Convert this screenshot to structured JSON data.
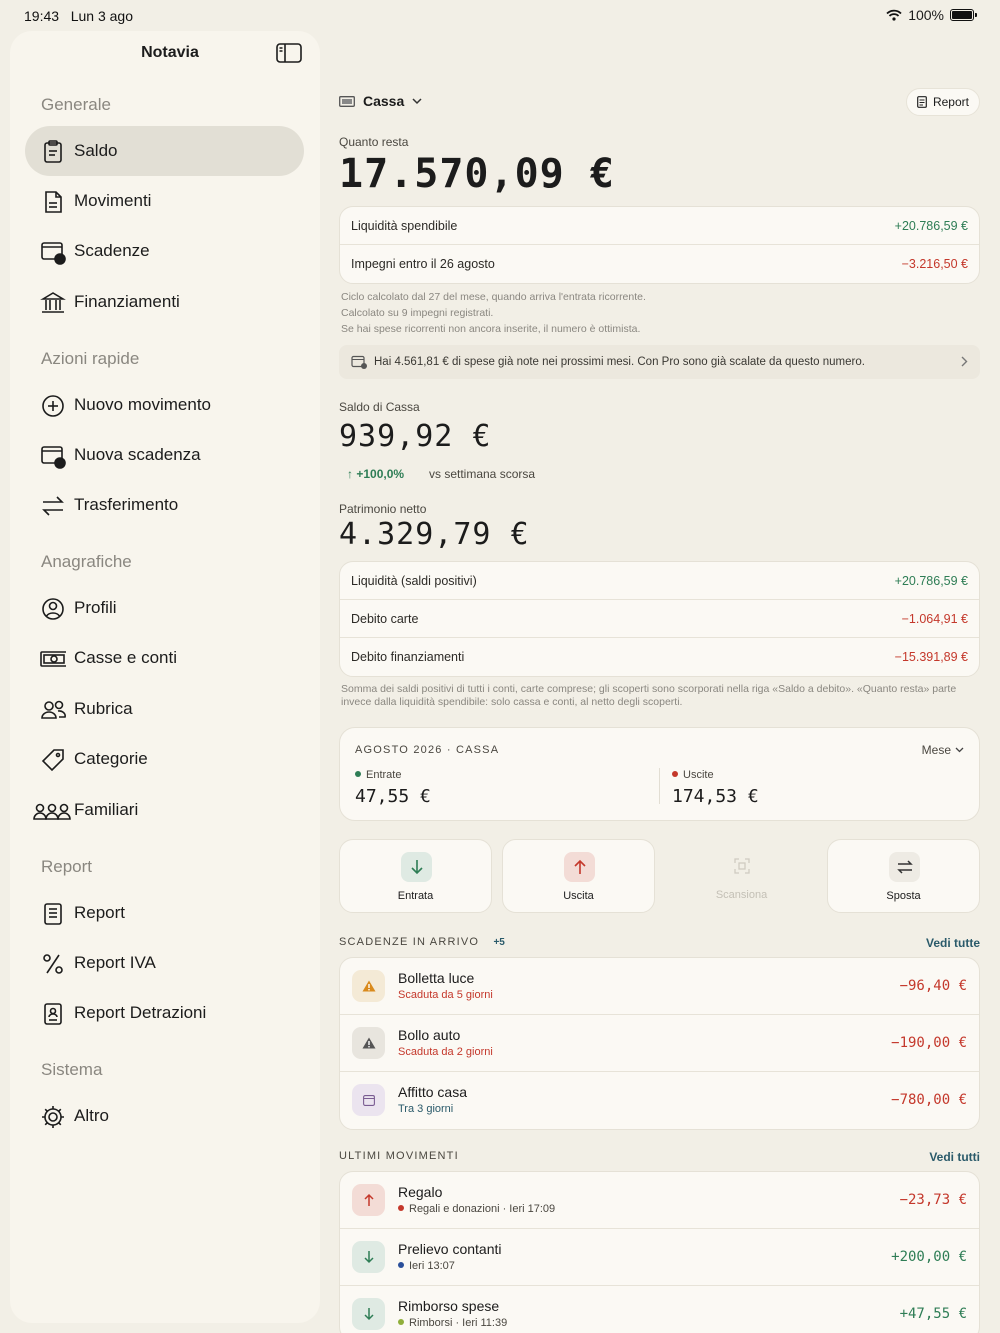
{
  "status": {
    "time": "19:43",
    "date": "Lun 3 ago",
    "battery": "100%"
  },
  "sidebar": {
    "title": "Notavia",
    "sections": {
      "generale": "Generale",
      "azioni": "Azioni rapide",
      "anagrafiche": "Anagrafiche",
      "report": "Report",
      "sistema": "Sistema"
    },
    "items": {
      "saldo": "Saldo",
      "movimenti": "Movimenti",
      "scadenze": "Scadenze",
      "finanziamenti": "Finanziamenti",
      "nuovo_movimento": "Nuovo movimento",
      "nuova_scadenza": "Nuova scadenza",
      "trasferimento": "Trasferimento",
      "profili": "Profili",
      "casse": "Casse e conti",
      "rubrica": "Rubrica",
      "categorie": "Categorie",
      "familiari": "Familiari",
      "report": "Report",
      "report_iva": "Report IVA",
      "report_detrazioni": "Report Detrazioni",
      "altro": "Altro"
    }
  },
  "main": {
    "account": "Cassa",
    "report_button": "Report",
    "remaining": {
      "label": "Quanto resta",
      "value": "17.570,09 €",
      "rows": [
        {
          "label": "Liquidità spendibile",
          "value": "+20.786,59 €",
          "kind": "pos"
        },
        {
          "label": "Impegni entro il 26 agosto",
          "value": "−3.216,50 €",
          "kind": "neg"
        }
      ],
      "notes": [
        "Ciclo calcolato dal 27 del mese, quando arriva l'entrata ricorrente.",
        "Calcolato su 9 impegni registrati.",
        "Se hai spese ricorrenti non ancora inserite, il numero è ottimista."
      ],
      "banner": "Hai 4.561,81 € di spese già note nei prossimi mesi. Con Pro sono già scalate da questo numero."
    },
    "balance": {
      "label": "Saldo di Cassa",
      "value": "939,92 €",
      "trend": "↑ +100,0%",
      "trend_caption": "vs settimana scorsa"
    },
    "net_worth": {
      "label": "Patrimonio netto",
      "value": "4.329,79 €",
      "rows": [
        {
          "label": "Liquidità (saldi positivi)",
          "value": "+20.786,59 €",
          "kind": "pos"
        },
        {
          "label": "Debito carte",
          "value": "−1.064,91 €",
          "kind": "neg"
        },
        {
          "label": "Debito finanziamenti",
          "value": "−15.391,89 €",
          "kind": "neg"
        }
      ],
      "note": "Somma dei saldi positivi di tutti i conti, carte comprese; gli scoperti sono scorporati nella riga «Saldo a debito». «Quanto resta» parte invece dalla liquidità spendibile: solo cassa e conti, al netto degli scoperti."
    },
    "period": {
      "title": "AGOSTO 2026 · CASSA",
      "selector": "Mese",
      "income_label": "Entrate",
      "income_value": "47,55 €",
      "expense_label": "Uscite",
      "expense_value": "174,53 €"
    },
    "actions": {
      "entrata": "Entrata",
      "uscita": "Uscita",
      "scansiona": "Scansiona",
      "sposta": "Sposta"
    },
    "upcoming": {
      "title": "SCADENZE IN ARRIVO",
      "count": "+5",
      "link": "Vedi tutte",
      "items": [
        {
          "title": "Bolletta luce",
          "subtitle": "Scaduta da 5 giorni",
          "amount": "−96,40 €"
        },
        {
          "title": "Bollo auto",
          "subtitle": "Scaduta da 2 giorni",
          "amount": "−190,00 €"
        },
        {
          "title": "Affitto casa",
          "subtitle": "Tra 3 giorni",
          "amount": "−780,00 €"
        }
      ]
    },
    "recent": {
      "title": "ULTIMI MOVIMENTI",
      "link": "Vedi tutti",
      "items": [
        {
          "title": "Regalo",
          "subtitle": "Regali e donazioni · Ieri 17:09",
          "amount": "−23,73 €"
        },
        {
          "title": "Prelievo contanti",
          "subtitle": "Ieri 13:07",
          "amount": "+200,00 €"
        },
        {
          "title": "Rimborso spese",
          "subtitle": "Rimborsi · Ieri 11:39",
          "amount": "+47,55 €"
        }
      ]
    }
  },
  "colors": {
    "positive": "#2e7d55",
    "negative": "#c4382b",
    "link": "#2a5a6a",
    "warning": "#d98a1c"
  }
}
